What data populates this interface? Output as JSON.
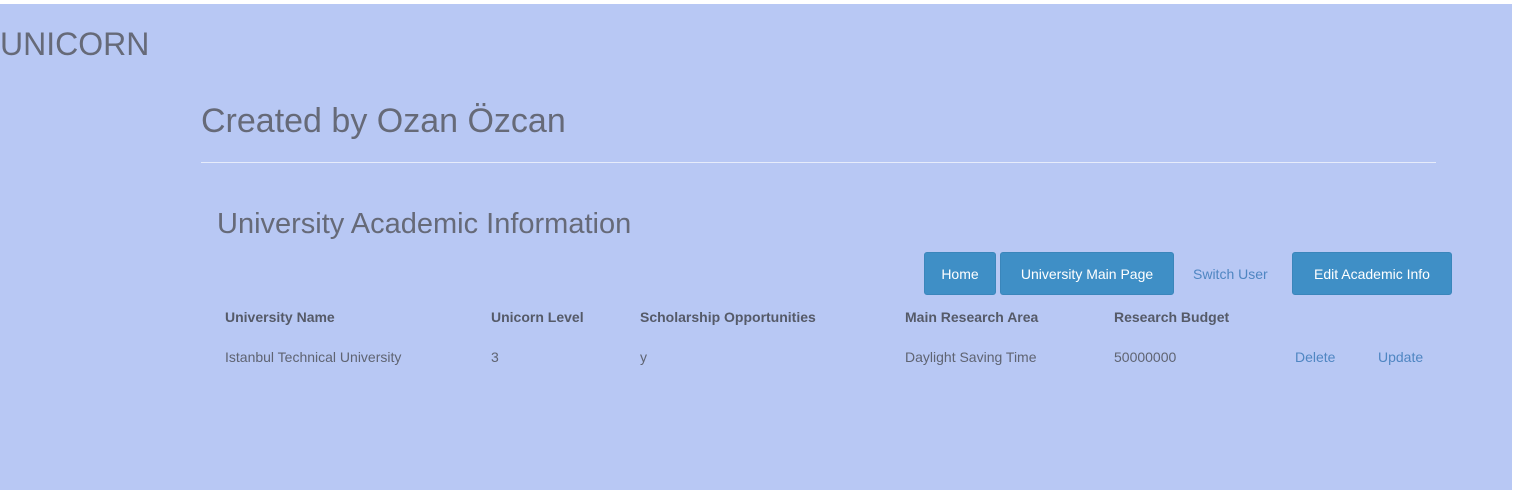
{
  "brand": "UNICORN",
  "subtitle": "Created by Ozan Özcan",
  "section_title": "University Academic Information",
  "nav": {
    "home": "Home",
    "university_main_page": "University Main Page",
    "switch_user": "Switch User",
    "edit_academic_info": "Edit Academic Info"
  },
  "table": {
    "headers": [
      "University Name",
      "Unicorn Level",
      "Scholarship Opportunities",
      "Main Research Area",
      "Research Budget"
    ],
    "rows": [
      {
        "university_name": "Istanbul Technical University",
        "unicorn_level": "3",
        "scholarship": "y",
        "main_research_area": "Daylight Saving Time",
        "research_budget": "50000000",
        "delete_label": "Delete",
        "update_label": "Update"
      }
    ]
  },
  "colors": {
    "background": "#b8c8f4",
    "button": "#3f8fc6",
    "link": "#4f86c2",
    "text": "#666a78"
  }
}
